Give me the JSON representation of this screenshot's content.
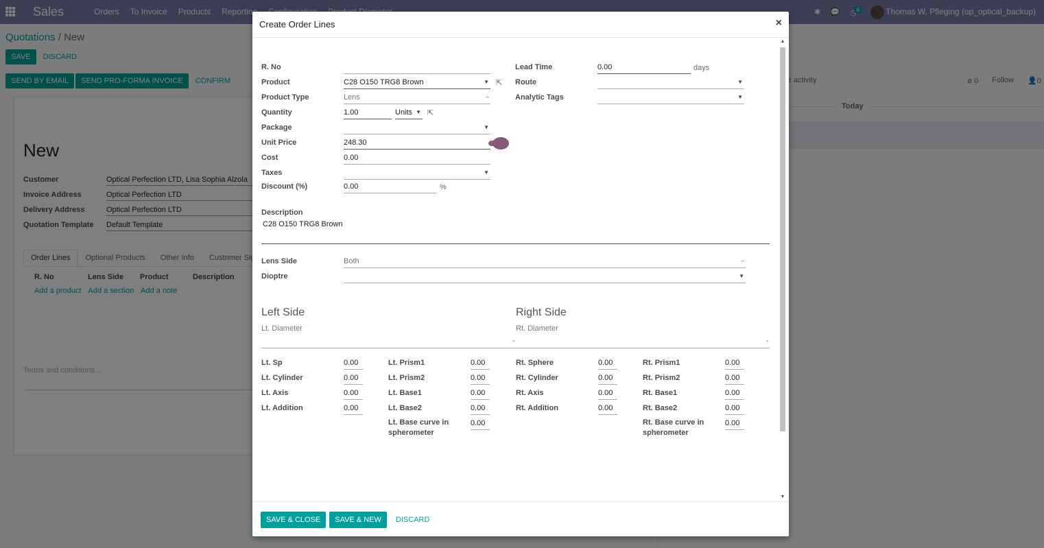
{
  "navbar": {
    "brand": "Sales",
    "menu": [
      "Orders",
      "To Invoice",
      "Products",
      "Reporting",
      "Configuration",
      "Product Diameter"
    ],
    "activity_count": "6",
    "user": "Thomas W. Pfleging (op_optical_backup)"
  },
  "page": {
    "breadcrumb_parent": "Quotations",
    "breadcrumb_sep": "/",
    "breadcrumb_current": "New",
    "save_label": "SAVE",
    "discard_label": "DISCARD",
    "send_email_label": "SEND BY EMAIL",
    "send_proforma_label": "SEND PRO-FORMA INVOICE",
    "confirm_label": "CONFIRM",
    "title": "New",
    "fields": [
      {
        "label": "Customer",
        "value": "Optical Perfection LTD, Lisa Sophia Alzola"
      },
      {
        "label": "Invoice Address",
        "value": "Optical Perfection LTD"
      },
      {
        "label": "Delivery Address",
        "value": "Optical Perfection LTD"
      },
      {
        "label": "Quotation Template",
        "value": "Default Template"
      }
    ],
    "tabs": [
      "Order Lines",
      "Optional Products",
      "Other Info",
      "Customer Signature"
    ],
    "columns": [
      "R. No",
      "Lens Side",
      "Product",
      "Description"
    ],
    "add_links": [
      "Add a product",
      "Add a section",
      "Add a note"
    ],
    "terms_placeholder": "Terms and conditions..."
  },
  "chatter": {
    "schedule_activity": "ule activity",
    "followers_count": "0",
    "follow_label": "Follow",
    "recipients_count": "0",
    "today_label": "Today"
  },
  "modal": {
    "title": "Create Order Lines",
    "close_symbol": "×",
    "left_fields": {
      "rno_label": "R. No",
      "product_label": "Product",
      "product_value": "C28 O150 TRG8 Brown",
      "product_type_label": "Product Type",
      "product_type_value": "Lens",
      "quantity_label": "Quantity",
      "quantity_value": "1.00",
      "uom_value": "Units",
      "package_label": "Package",
      "unit_price_label": "Unit Price",
      "unit_price_value": "248.30",
      "cost_label": "Cost",
      "cost_value": "0.00",
      "taxes_label": "Taxes",
      "discount_label": "Discount (%)",
      "discount_value": "0.00",
      "discount_unit": "%"
    },
    "right_fields": {
      "lead_time_label": "Lead Time",
      "lead_time_value": "0.00",
      "lead_time_unit": "days",
      "route_label": "Route",
      "analytic_tags_label": "Analytic Tags"
    },
    "description_label": "Description",
    "description_value": "C28 O150 TRG8 Brown",
    "lens_side_label": "Lens Side",
    "lens_side_value": "Both",
    "dioptre_label": "Dioptre",
    "left_side": {
      "title": "Left Side",
      "diameter_label": "Lt. Diameter",
      "col1": [
        {
          "label": "Lt. Sp",
          "value": "0.00"
        },
        {
          "label": "Lt. Cylinder",
          "value": "0.00"
        },
        {
          "label": "Lt. Axis",
          "value": "0.00"
        },
        {
          "label": "Lt. Addition",
          "value": "0.00"
        }
      ],
      "col2": [
        {
          "label": "Lt. Prism1",
          "value": "0.00"
        },
        {
          "label": "Lt. Prism2",
          "value": "0.00"
        },
        {
          "label": "Lt. Base1",
          "value": "0.00"
        },
        {
          "label": "Lt. Base2",
          "value": "0.00"
        },
        {
          "label": "Lt. Base curve in spherometer",
          "value": "0.00"
        }
      ]
    },
    "right_side": {
      "title": "Right Side",
      "diameter_label": "Rt. Diameter",
      "col1": [
        {
          "label": "Rt. Sphere",
          "value": "0.00"
        },
        {
          "label": "Rt. Cylinder",
          "value": "0.00"
        },
        {
          "label": "Rt. Axis",
          "value": "0.00"
        },
        {
          "label": "Rt. Addition",
          "value": "0.00"
        }
      ],
      "col2": [
        {
          "label": "Rt. Prism1",
          "value": "0.00"
        },
        {
          "label": "Rt. Prism2",
          "value": "0.00"
        },
        {
          "label": "Rt. Base1",
          "value": "0.00"
        },
        {
          "label": "Rt. Base2",
          "value": "0.00"
        },
        {
          "label": "Rt. Base curve in spherometer",
          "value": "0.00"
        }
      ]
    },
    "save_close_label": "SAVE & CLOSE",
    "save_new_label": "SAVE & NEW",
    "discard_label": "DISCARD"
  },
  "colors": {
    "navbar": "#7c7bad",
    "primary": "#00a09d",
    "accent": "#875a7b"
  }
}
